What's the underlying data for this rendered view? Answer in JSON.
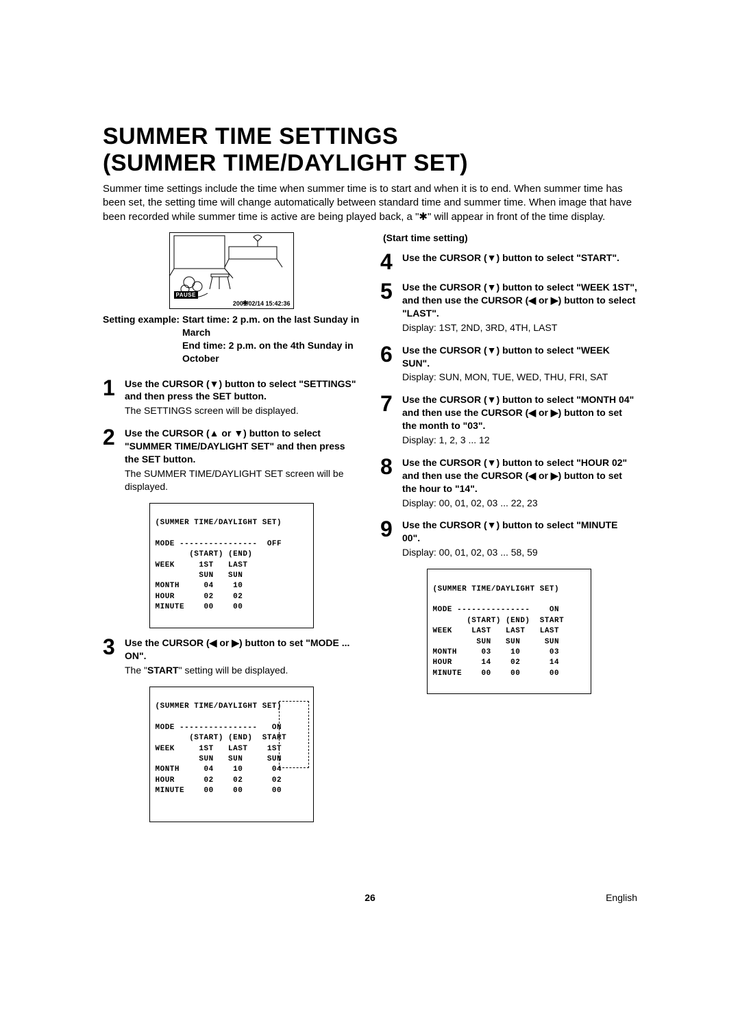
{
  "title_line1": "SUMMER TIME SETTINGS",
  "title_line2": "(SUMMER TIME/DAYLIGHT SET)",
  "intro": "Summer time settings include the time when summer time is to start and when it is to end. When summer time has been set, the setting time will change automatically between standard time and summer time. When image that have been recorded while summer time is active are being played back, a \"✱\" will appear in front of the time display.",
  "illust": {
    "pause": "PAUSE",
    "timestamp": "2001/02/14   15:42:36",
    "star": "✱"
  },
  "example": {
    "label": "Setting example:",
    "line1": "Start time: 2 p.m. on the last Sunday in March",
    "line2": "End time: 2 p.m. on the 4th Sunday in October"
  },
  "steps_left": [
    {
      "n": "1",
      "bold": "Use the CURSOR (▼) button to select \"SETTINGS\" and then press the SET button.",
      "sub": "The SETTINGS screen will be displayed."
    },
    {
      "n": "2",
      "bold": "Use the CURSOR (▲ or ▼) button to select \"SUMMER TIME/DAYLIGHT SET\" and then press the SET button.",
      "sub": "The SUMMER TIME/DAYLIGHT SET screen will be displayed."
    },
    {
      "n": "3",
      "bold": "Use the CURSOR (◀ or ▶) button to set \"MODE ... ON\".",
      "sub_html": "The \"START\" setting will be displayed.",
      "sub_strong": "START"
    }
  ],
  "osd1": {
    "title": "(SUMMER TIME/DAYLIGHT SET)",
    "rows": [
      "MODE ----------------  OFF",
      "       (START) (END)",
      "WEEK     1ST   LAST",
      "         SUN   SUN",
      "MONTH     04    10",
      "HOUR      02    02",
      "MINUTE    00    00"
    ]
  },
  "osd2": {
    "title": "(SUMMER TIME/DAYLIGHT SET)",
    "rows": [
      "MODE ----------------   ON",
      "       (START) (END)  START",
      "WEEK     1ST   LAST    1ST",
      "         SUN   SUN     SUN",
      "MONTH     04    10      04",
      "HOUR      02    02      02",
      "MINUTE    00    00      00"
    ]
  },
  "right_head": "(Start time setting)",
  "steps_right": [
    {
      "n": "4",
      "bold": "Use the CURSOR (▼) button to select \"START\"."
    },
    {
      "n": "5",
      "bold": "Use the CURSOR (▼) button to select \"WEEK 1ST\", and then use the CURSOR (◀ or ▶) button to select \"LAST\".",
      "sub": "Display: 1ST, 2ND, 3RD, 4TH, LAST"
    },
    {
      "n": "6",
      "bold": "Use the CURSOR (▼) button to select \"WEEK SUN\".",
      "sub": "Display: SUN, MON, TUE, WED, THU, FRI, SAT"
    },
    {
      "n": "7",
      "bold": "Use the CURSOR (▼) button to select \"MONTH 04\" and then use the CURSOR (◀ or ▶) button to set the month to \"03\".",
      "sub": "Display: 1, 2, 3 ... 12"
    },
    {
      "n": "8",
      "bold": "Use the CURSOR (▼) button to select \"HOUR 02\" and then use the CURSOR (◀ or ▶) button to set the hour to \"14\".",
      "sub": "Display: 00, 01, 02, 03 ... 22, 23"
    },
    {
      "n": "9",
      "bold": "Use the CURSOR (▼) button to select \"MINUTE 00\".",
      "sub": "Display: 00, 01, 02, 03 ... 58, 59"
    }
  ],
  "osd3": {
    "title": "(SUMMER TIME/DAYLIGHT SET)",
    "rows": [
      "MODE ---------------    ON",
      "       (START) (END)  START",
      "WEEK    LAST   LAST   LAST",
      "         SUN   SUN     SUN",
      "MONTH     03    10      03",
      "HOUR      14    02      14",
      "MINUTE    00    00      00"
    ]
  },
  "footer": {
    "page": "26",
    "lang": "English"
  }
}
